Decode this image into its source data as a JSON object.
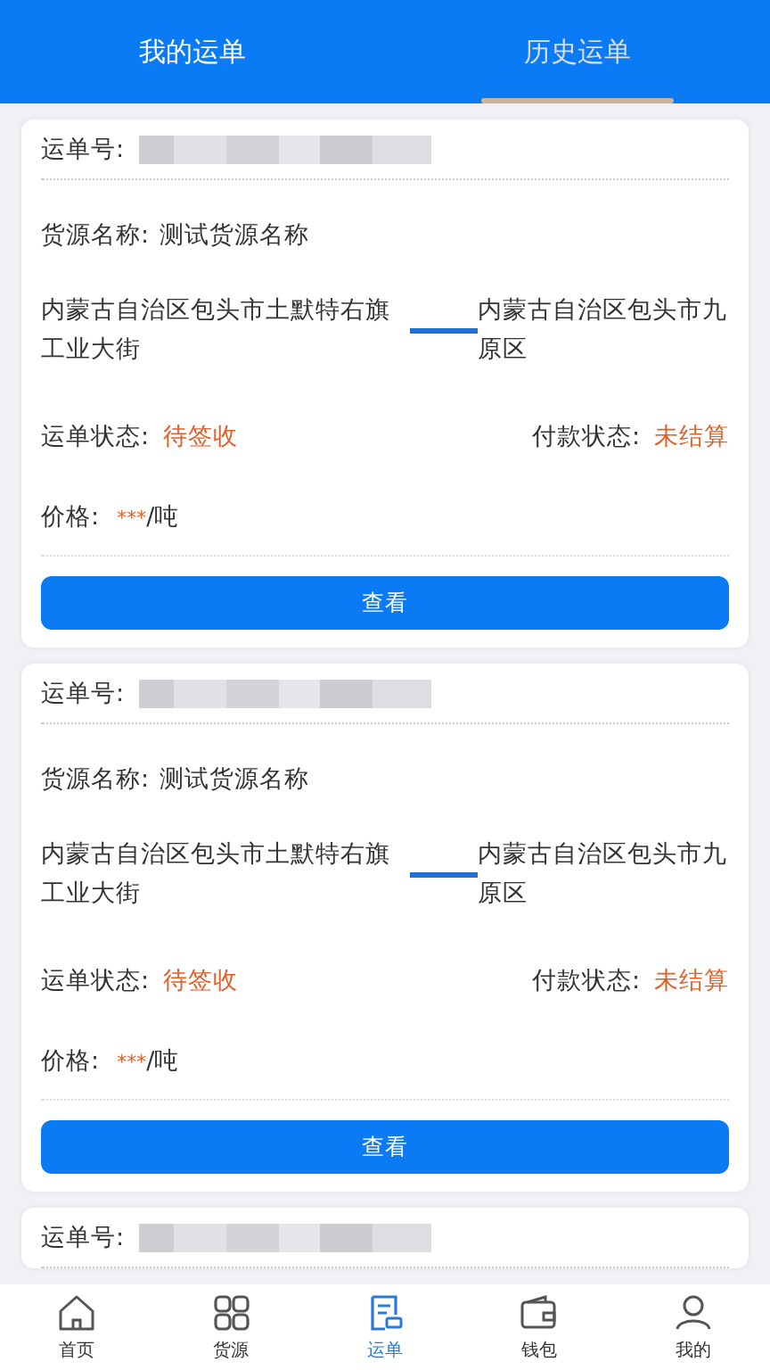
{
  "tabs": [
    {
      "label": "我的运单",
      "selected": false
    },
    {
      "label": "历史运单",
      "selected": true
    }
  ],
  "waybills": [
    {
      "order_label": "运单号:",
      "cargo_label": "货源名称:",
      "cargo_name": "测试货源名称",
      "origin": "内蒙古自治区包头市土默特右旗工业大街",
      "destination": "内蒙古自治区包头市九原区",
      "status_label": "运单状态:",
      "status": "待签收",
      "payment_label": "付款状态:",
      "payment": "未结算",
      "price_label": "价格:",
      "price_value": "***",
      "price_unit": "/吨",
      "button": "查看"
    },
    {
      "order_label": "运单号:",
      "cargo_label": "货源名称:",
      "cargo_name": "测试货源名称",
      "origin": "内蒙古自治区包头市土默特右旗工业大街",
      "destination": "内蒙古自治区包头市九原区",
      "status_label": "运单状态:",
      "status": "待签收",
      "payment_label": "付款状态:",
      "payment": "未结算",
      "price_label": "价格:",
      "price_value": "***",
      "price_unit": "/吨",
      "button": "查看"
    },
    {
      "order_label": "运单号:"
    }
  ],
  "nav": [
    {
      "label": "首页",
      "kind": "home",
      "selected": false
    },
    {
      "label": "货源",
      "kind": "grid",
      "selected": false
    },
    {
      "label": "运单",
      "kind": "document",
      "selected": true
    },
    {
      "label": "钱包",
      "kind": "wallet",
      "selected": false
    },
    {
      "label": "我的",
      "kind": "person",
      "selected": false
    }
  ]
}
